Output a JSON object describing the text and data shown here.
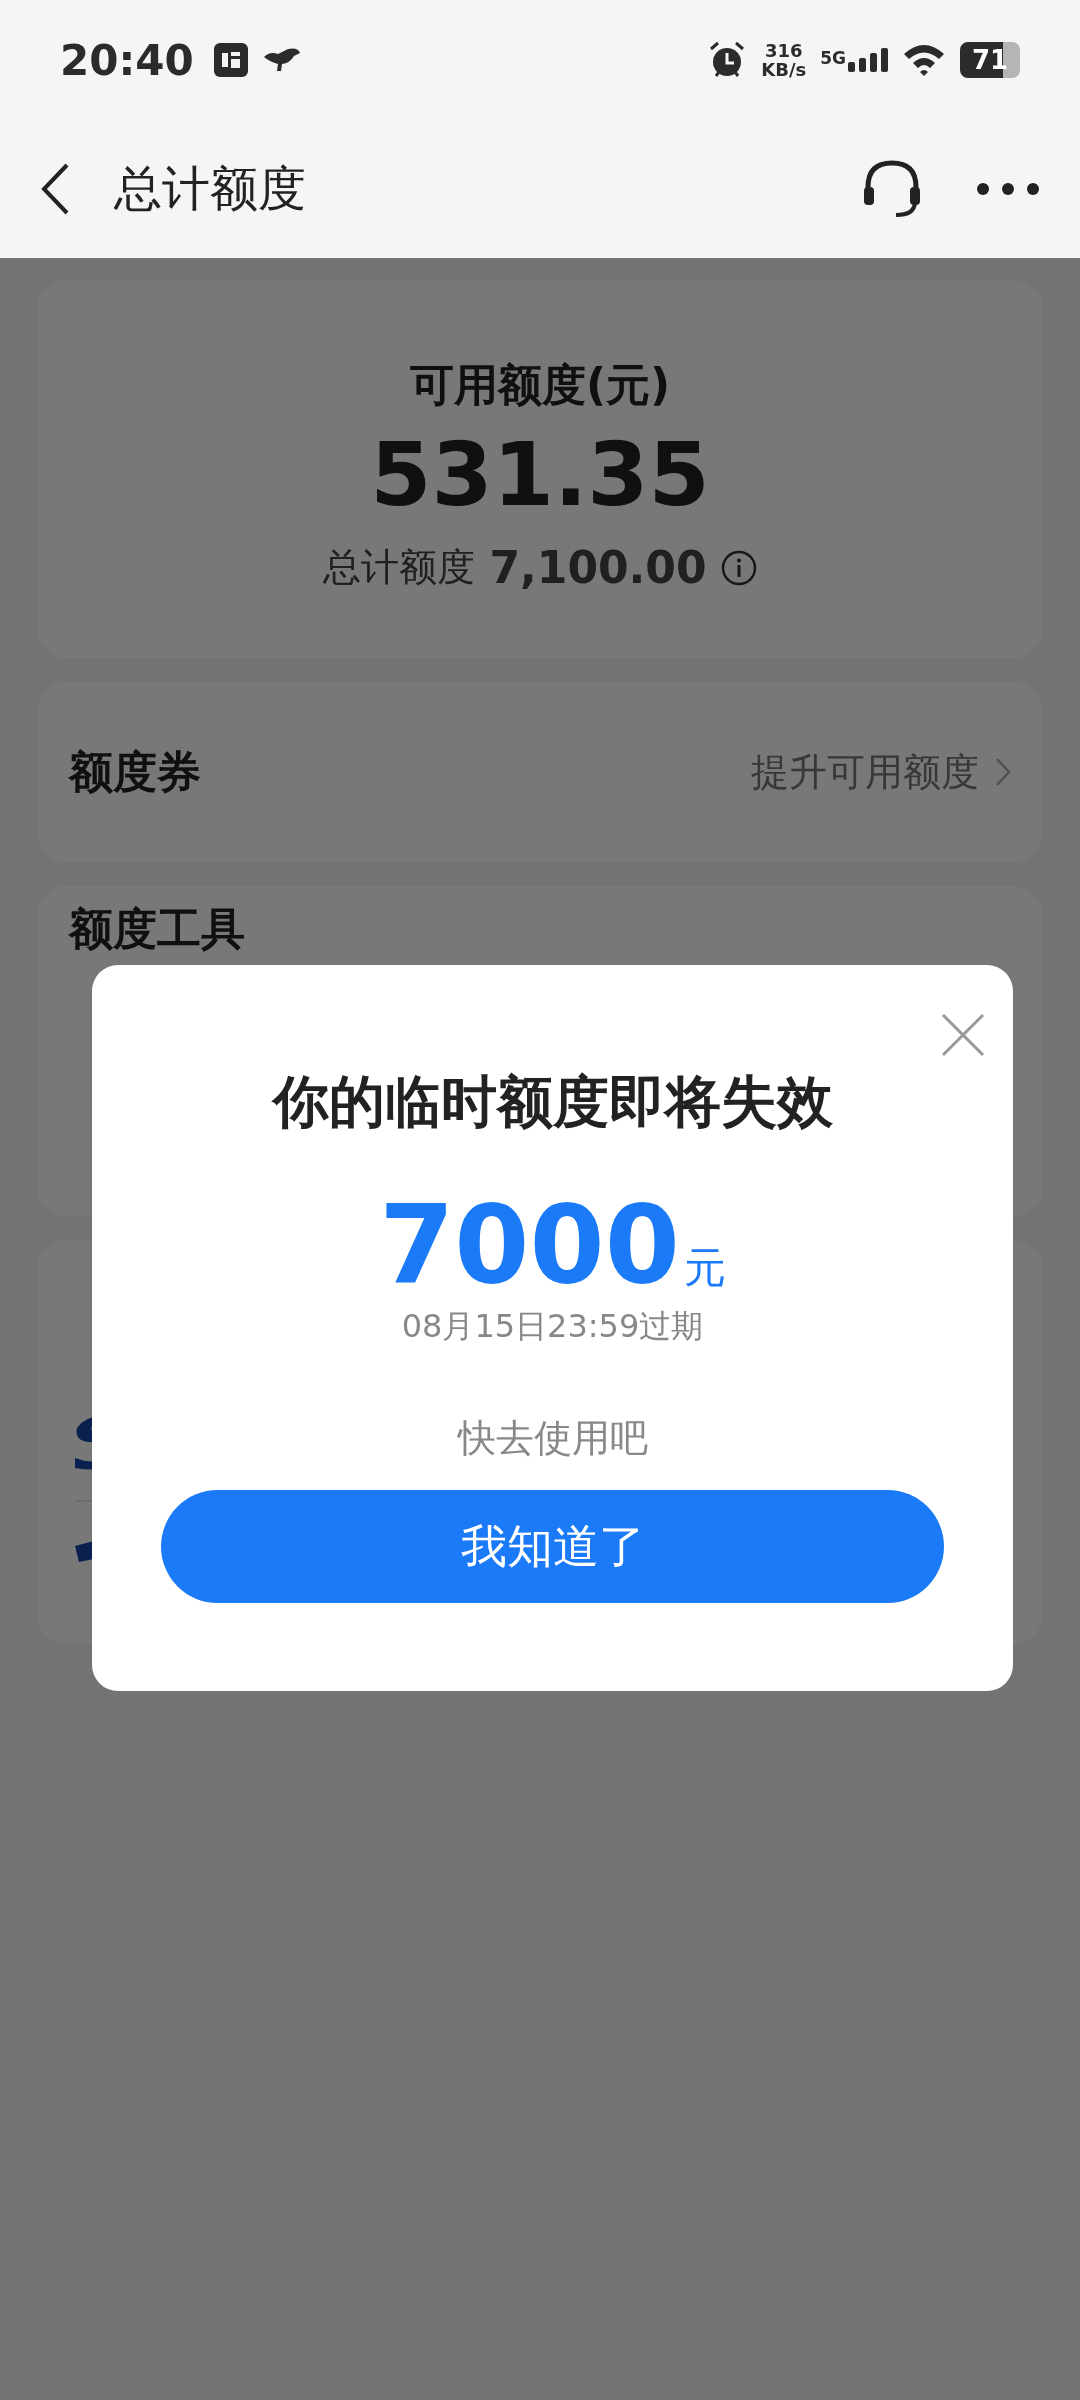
{
  "status_bar": {
    "time": "20:40",
    "speed": "316",
    "speed_unit": "KB/s",
    "network": "5G",
    "battery": "71"
  },
  "header": {
    "title": "总计额度"
  },
  "summary": {
    "label": "可用额度(元)",
    "amount": "531.35",
    "total_label": "总计额度",
    "total": "7,100.00"
  },
  "coupon": {
    "title": "额度券",
    "action": "提升可用额度"
  },
  "tools": {
    "title": "额度工具"
  },
  "dialog": {
    "title": "你的临时额度即将失效",
    "amount": "7000",
    "unit": "元",
    "expiry": "08月15日23:59过期",
    "hint": "快去使用吧",
    "button": "我知道了"
  }
}
